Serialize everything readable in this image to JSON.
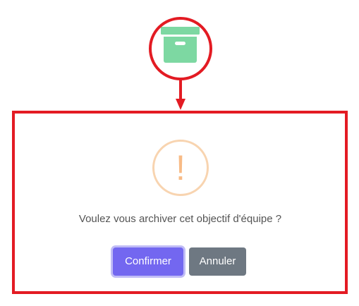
{
  "icons": {
    "archive": "archive-box-icon",
    "warning": "exclamation-circle-icon"
  },
  "dialog": {
    "warning_glyph": "!",
    "message": "Voulez vous archiver cet objectif d'équipe ?",
    "confirm_label": "Confirmer",
    "cancel_label": "Annuler"
  },
  "colors": {
    "annotation_red": "#e31b23",
    "archive_green": "#7dd8a2",
    "warning_orange": "#f8bb86",
    "confirm_purple": "#7367f0",
    "cancel_gray": "#6e7882"
  }
}
